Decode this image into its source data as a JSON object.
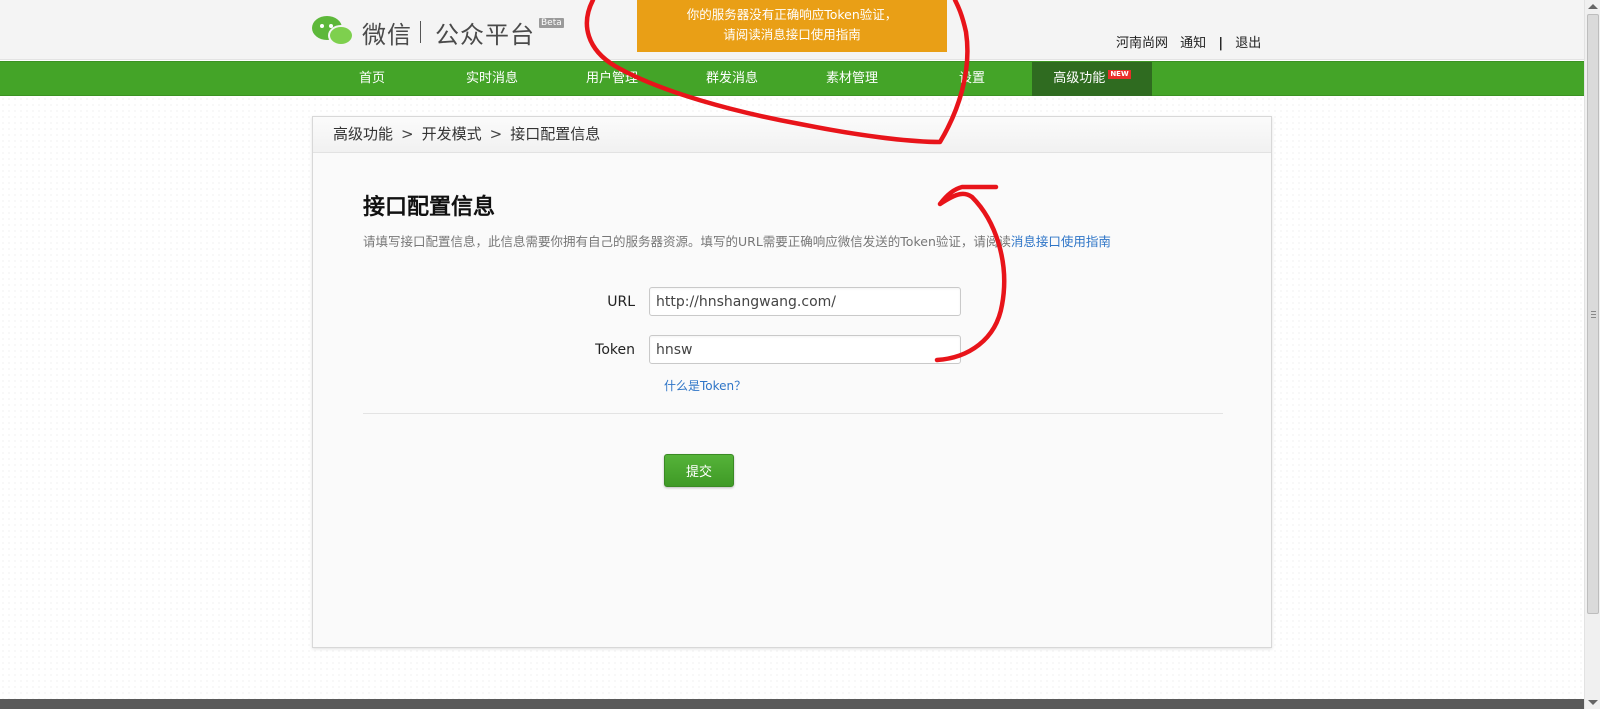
{
  "header": {
    "logo_text": "微信",
    "logo_subtitle": "公众平台",
    "beta_label": "Beta",
    "alert_line1": "你的服务器没有正确响应Token验证，",
    "alert_line2": "请阅读消息接口使用指南",
    "links": {
      "account": "河南尚网",
      "notifications": "通知",
      "logout": "退出"
    }
  },
  "nav": {
    "items": [
      {
        "label": "首页"
      },
      {
        "label": "实时消息"
      },
      {
        "label": "用户管理"
      },
      {
        "label": "群发消息"
      },
      {
        "label": "素材管理"
      },
      {
        "label": "设置"
      },
      {
        "label": "高级功能",
        "badge": "NEW",
        "active": true
      }
    ]
  },
  "breadcrumb": {
    "items": [
      "高级功能",
      "开发模式",
      "接口配置信息"
    ],
    "separator": ">"
  },
  "main": {
    "title": "接口配置信息",
    "description": "请填写接口配置信息，此信息需要你拥有自己的服务器资源。填写的URL需要正确响应微信发送的Token验证，请阅读",
    "description_link": "消息接口使用指南",
    "form": {
      "url_label": "URL",
      "url_value": "http://hnshangwang.com/",
      "token_label": "Token",
      "token_value": "hnsw",
      "token_help": "什么是Token？"
    },
    "submit_label": "提交"
  },
  "colors": {
    "nav_green": "#44a428",
    "nav_active": "#2f6b20",
    "alert_orange": "#e99f16",
    "link_blue": "#2e75c7",
    "annotation_red": "#e8141a"
  }
}
